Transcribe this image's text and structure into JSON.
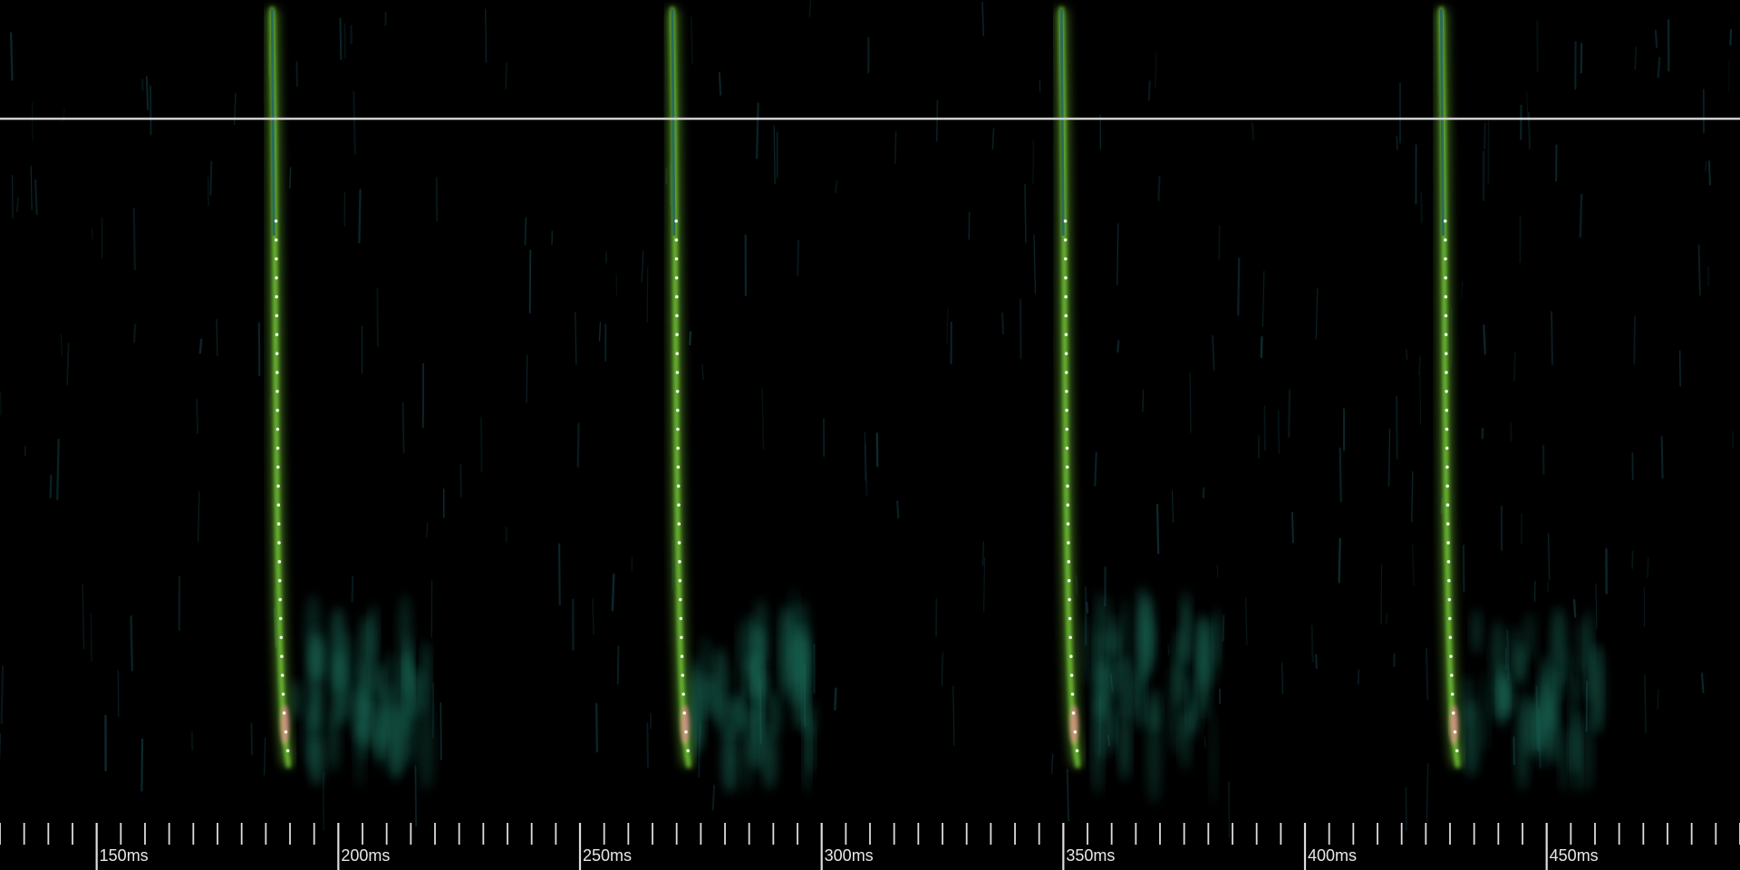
{
  "view": {
    "time_start_ms": 130,
    "time_end_ms": 490,
    "background": "#000000",
    "reference_line_color": "#cfcfcf",
    "tick_color": "#dddddd",
    "label_color": "#e8e8e8",
    "glow_color": "#7cd63a",
    "core_color": "#e9ff6a",
    "haze_color": "#1f6e5c",
    "peak_color": "#ff8fa0",
    "marker_color": "#ffffff"
  },
  "time_ruler": {
    "major_step_ms": 50,
    "minor_step_ms": 5,
    "labels": [
      {
        "ms": 150,
        "text": "150ms"
      },
      {
        "ms": 200,
        "text": "200ms"
      },
      {
        "ms": 250,
        "text": "250ms"
      },
      {
        "ms": 300,
        "text": "300ms"
      },
      {
        "ms": 350,
        "text": "350ms"
      },
      {
        "ms": 400,
        "text": "400ms"
      },
      {
        "ms": 450,
        "text": "450ms"
      }
    ]
  },
  "calls": [
    {
      "id": 1,
      "end_ms": 189.3
    },
    {
      "id": 2,
      "end_ms": 272.1
    },
    {
      "id": 3,
      "end_ms": 352.6
    },
    {
      "id": 4,
      "end_ms": 431.2
    }
  ]
}
